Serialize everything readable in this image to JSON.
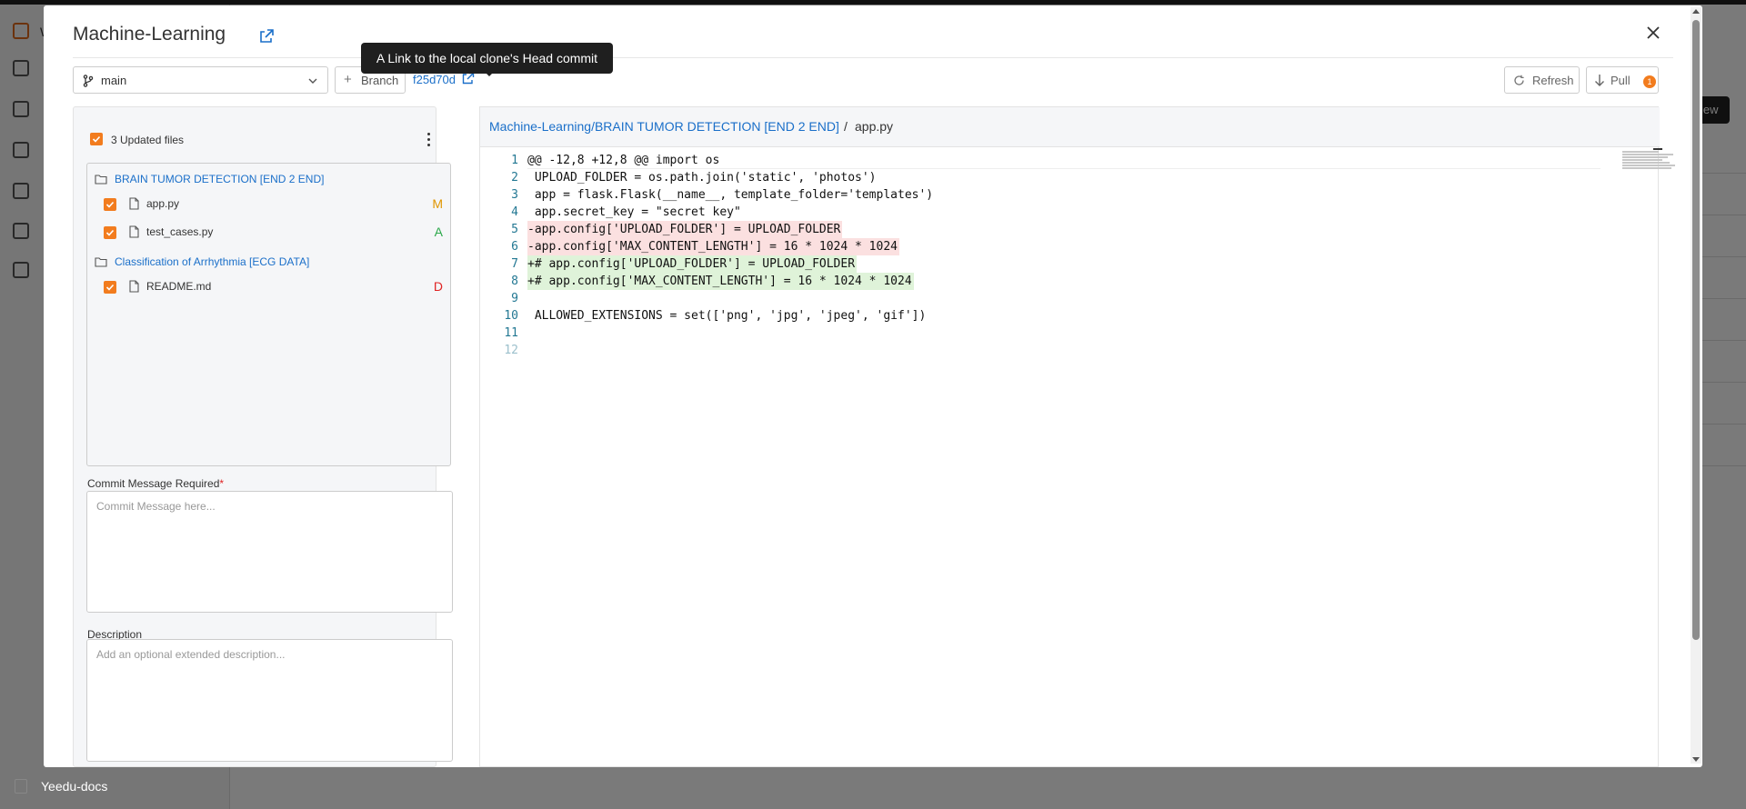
{
  "background": {
    "footer_item_label": "Yeedu-docs",
    "view_button_label": "iew",
    "sidebar_partial_label": "W"
  },
  "modal": {
    "title": "Machine-Learning",
    "tooltip": "A Link to the local clone's Head commit",
    "toolbar": {
      "branch": "main",
      "new_branch_label": "Branch",
      "commit_hash": "f25d70d",
      "refresh_label": "Refresh",
      "pull_label": "Pull",
      "pull_badge": "1"
    },
    "changes": {
      "updated_files_label": "3 Updated files",
      "folders": [
        {
          "name": "BRAIN TUMOR DETECTION [END 2 END]",
          "files": [
            {
              "name": "app.py",
              "status": "M"
            },
            {
              "name": "test_cases.py",
              "status": "A"
            }
          ]
        },
        {
          "name": "Classification of Arrhythmia [ECG DATA]",
          "files": [
            {
              "name": "README.md",
              "status": "D"
            }
          ]
        }
      ]
    },
    "commit": {
      "message_label": "Commit Message Required",
      "required_mark": "*",
      "message_placeholder": "Commit Message here...",
      "description_label": "Description",
      "description_placeholder": "Add an optional extended description..."
    },
    "diff": {
      "path": "Machine-Learning/BRAIN TUMOR DETECTION [END 2 END]",
      "separator": "/",
      "filename": "app.py",
      "lines": [
        {
          "no": "1",
          "text": "@@ -12,8 +12,8 @@ import os",
          "type": "hunk"
        },
        {
          "no": "2",
          "text": " UPLOAD_FOLDER = os.path.join('static', 'photos')",
          "type": "ctx"
        },
        {
          "no": "3",
          "text": " app = flask.Flask(__name__, template_folder='templates')",
          "type": "ctx"
        },
        {
          "no": "4",
          "text": " app.secret_key = \"secret key\"",
          "type": "ctx"
        },
        {
          "no": "5",
          "text": "-app.config['UPLOAD_FOLDER'] = UPLOAD_FOLDER",
          "type": "del"
        },
        {
          "no": "6",
          "text": "-app.config['MAX_CONTENT_LENGTH'] = 16 * 1024 * 1024",
          "type": "del"
        },
        {
          "no": "7",
          "text": "+# app.config['UPLOAD_FOLDER'] = UPLOAD_FOLDER",
          "type": "add"
        },
        {
          "no": "8",
          "text": "+# app.config['MAX_CONTENT_LENGTH'] = 16 * 1024 * 1024",
          "type": "add"
        },
        {
          "no": "9",
          "text": "",
          "type": "ctx"
        },
        {
          "no": "10",
          "text": " ALLOWED_EXTENSIONS = set(['png', 'jpg', 'jpeg', 'gif'])",
          "type": "ctx"
        },
        {
          "no": "11",
          "text": "",
          "type": "ctx"
        },
        {
          "no": "12",
          "text": "",
          "type": "dim"
        }
      ]
    }
  }
}
